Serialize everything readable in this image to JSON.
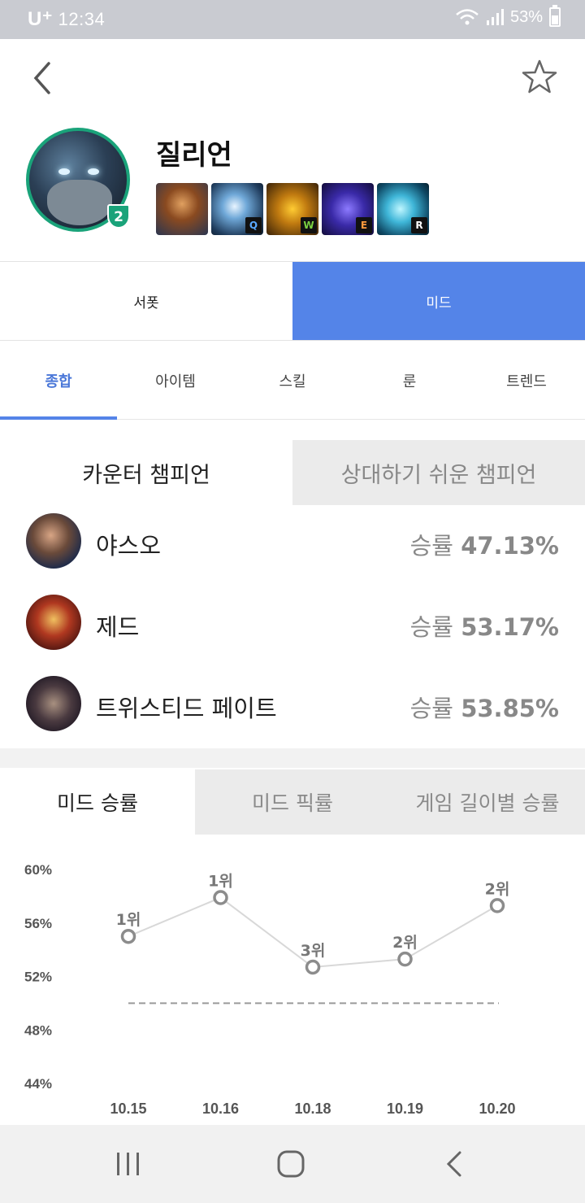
{
  "status_bar": {
    "carrier": "U⁺",
    "time": "12:34",
    "battery": "53%",
    "battery_level": 0.53
  },
  "header": {
    "champion_name": "질리언",
    "level_badge": "2"
  },
  "skills": [
    {
      "key": "",
      "name": "passive"
    },
    {
      "key": "Q",
      "name": "q"
    },
    {
      "key": "W",
      "name": "w"
    },
    {
      "key": "E",
      "name": "e"
    },
    {
      "key": "R",
      "name": "r"
    }
  ],
  "position_tabs": [
    {
      "label": "서폿",
      "active": false
    },
    {
      "label": "미드",
      "active": true
    }
  ],
  "sub_tabs": [
    {
      "label": "종합",
      "active": true
    },
    {
      "label": "아이템",
      "active": false
    },
    {
      "label": "스킬",
      "active": false
    },
    {
      "label": "룬",
      "active": false
    },
    {
      "label": "트렌드",
      "active": false
    }
  ],
  "counter_tabs": [
    {
      "label": "카운터 챔피언",
      "active": true
    },
    {
      "label": "상대하기 쉬운 챔피언",
      "active": false
    }
  ],
  "counters": [
    {
      "name": "야스오",
      "rate_label": "승률",
      "rate": "47.13%"
    },
    {
      "name": "제드",
      "rate_label": "승률",
      "rate": "53.17%"
    },
    {
      "name": "트위스티드 페이트",
      "rate_label": "승률",
      "rate": "53.85%"
    }
  ],
  "stat_tabs": [
    {
      "label": "미드 승률",
      "active": true
    },
    {
      "label": "미드 픽률",
      "active": false
    },
    {
      "label": "게임 길이별 승률",
      "active": false
    }
  ],
  "chart_data": {
    "type": "line",
    "categories": [
      "10.15",
      "10.16",
      "10.18",
      "10.19",
      "10.20"
    ],
    "values": [
      55.0,
      57.9,
      52.7,
      53.3,
      57.3
    ],
    "point_labels": [
      "1위",
      "1위",
      "3위",
      "2위",
      "2위"
    ],
    "y_ticks": [
      "60%",
      "56%",
      "52%",
      "48%",
      "44%"
    ],
    "ylim": [
      44,
      60
    ],
    "reference_line": 50,
    "colors": {
      "line": "#d8d8d8",
      "point": "#8c8c8c",
      "reference": "#9a9a9a"
    }
  },
  "colors": {
    "accent": "#5484e8",
    "badge": "#1aa37a"
  }
}
